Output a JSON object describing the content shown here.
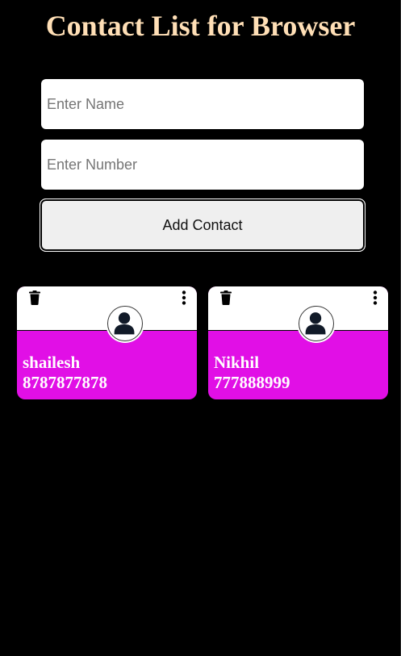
{
  "page": {
    "title": "Contact List for Browser"
  },
  "form": {
    "name_placeholder": "Enter Name",
    "number_placeholder": "Enter Number",
    "add_button_label": "Add Contact"
  },
  "contacts": [
    {
      "name": "shailesh",
      "number": "8787877878"
    },
    {
      "name": "Nikhil",
      "number": "777888999"
    }
  ],
  "colors": {
    "background": "#000000",
    "title": "#ffdfb6",
    "card_accent": "#e10fe6",
    "card_top": "#ffffff"
  },
  "icons": {
    "delete": "trash-icon",
    "menu": "kebab-menu-icon",
    "avatar": "user-avatar-icon"
  }
}
